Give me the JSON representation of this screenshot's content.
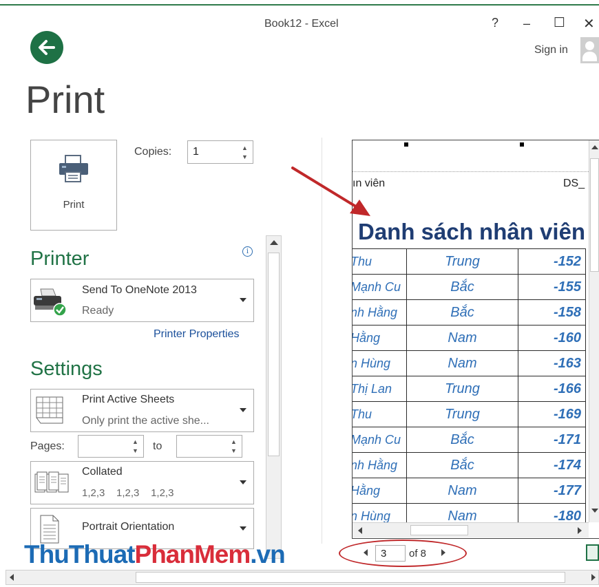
{
  "window": {
    "title": "Book12 - Excel",
    "help": "?",
    "minimize": "–",
    "maximize": "☐",
    "close": "✕",
    "sign_in": "Sign in"
  },
  "backstage": {
    "title": "Print",
    "print_button_label": "Print",
    "copies_label": "Copies:",
    "copies_value": "1",
    "printer_section": "Printer",
    "printer": {
      "name": "Send To OneNote 2013",
      "status": "Ready"
    },
    "printer_properties": "Printer Properties",
    "settings_section": "Settings",
    "settings": [
      {
        "title": "Print Active Sheets",
        "subtitle": "Only print the active she..."
      },
      {
        "title": "Collated",
        "subtitle": "1,2,3    1,2,3    1,2,3"
      },
      {
        "title": "Portrait Orientation",
        "subtitle": ""
      }
    ],
    "pages_label": "Pages:",
    "pages_to": "to",
    "pages_from_value": "",
    "pages_to_value": ""
  },
  "preview": {
    "header_left": "ın viên",
    "header_right": "DS_",
    "sheet_title": "Danh sách nhân viên",
    "rows": [
      [
        "Thu",
        "Trung",
        "-152"
      ],
      [
        "Mạnh Cu",
        "Bắc",
        "-155"
      ],
      [
        "nh Hằng",
        "Bắc",
        "-158"
      ],
      [
        "Hằng",
        "Nam",
        "-160"
      ],
      [
        "n Hùng",
        "Nam",
        "-163"
      ],
      [
        "Thị Lan",
        "Trung",
        "-166"
      ],
      [
        "Thu",
        "Trung",
        "-169"
      ],
      [
        "Mạnh Cu",
        "Bắc",
        "-171"
      ],
      [
        "nh Hằng",
        "Bắc",
        "-174"
      ],
      [
        "Hằng",
        "Nam",
        "-177"
      ],
      [
        "n Hùng",
        "Nam",
        "-180"
      ]
    ]
  },
  "page_nav": {
    "current": "3",
    "of_text": "of 8"
  },
  "watermark": {
    "part1": "ThuThuat",
    "part2": "PhanMem",
    "part3": ".vn"
  },
  "colors": {
    "accent_green": "#217346",
    "link_blue": "#1a4f9a",
    "annotation_red": "#c0282a",
    "table_text_blue": "#2f6fb7",
    "title_navy": "#1f3d73"
  }
}
